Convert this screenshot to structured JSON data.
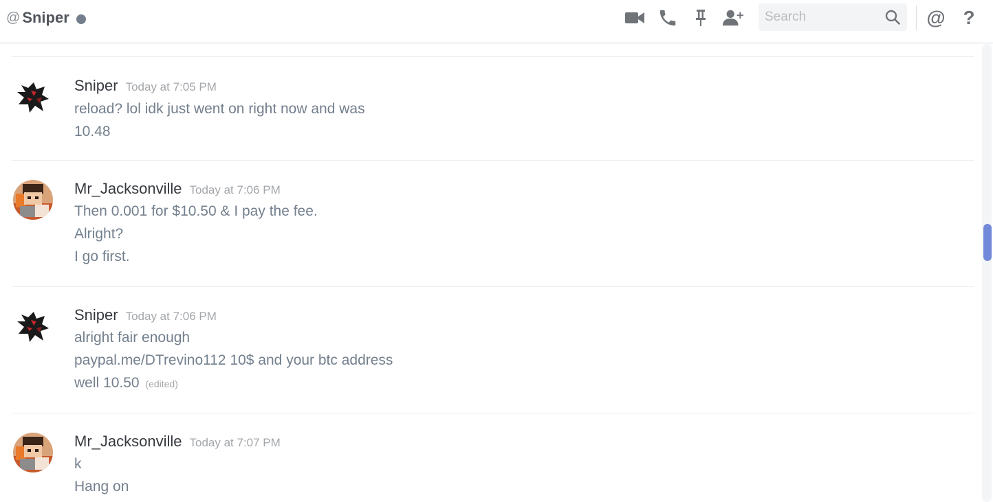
{
  "header": {
    "at_symbol": "@",
    "name": "Sniper",
    "status_color": "#747f8d",
    "icons": [
      "video-call-icon",
      "voice-call-icon",
      "pin-icon",
      "add-friend-icon"
    ],
    "search_placeholder": "Search",
    "mentions_symbol": "@",
    "help_symbol": "?"
  },
  "colors": {
    "accent": "#7289da",
    "username": "#36393f",
    "message_text": "#737f8d",
    "timestamp": "#a3a6aa"
  },
  "messages": [
    {
      "author": "Sniper",
      "timestamp": "Today at 7:05 PM",
      "avatar": "dark-dragon-avatar",
      "lines": [
        "reload? lol idk just went on right now and was",
        "10.48"
      ]
    },
    {
      "author": "Mr_Jacksonville",
      "timestamp": "Today at 7:06 PM",
      "avatar": "character-avatar",
      "lines": [
        "Then 0.001 for $10.50 & I pay the fee.",
        "Alright?",
        "I go first."
      ]
    },
    {
      "author": "Sniper",
      "timestamp": "Today at 7:06 PM",
      "avatar": "dark-dragon-avatar",
      "lines": [
        "alright fair enough",
        "paypal.me/DTrevino112 10$ and your btc address",
        "well 10.50"
      ],
      "edited_label": "(edited)"
    },
    {
      "author": "Mr_Jacksonville",
      "timestamp": "Today at 7:07 PM",
      "avatar": "character-avatar",
      "lines": [
        "k",
        "Hang on"
      ]
    }
  ]
}
